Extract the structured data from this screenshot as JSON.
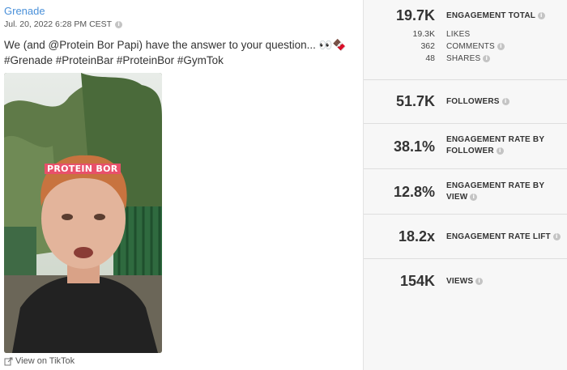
{
  "post": {
    "brand": "Grenade",
    "date": "Jul. 20, 2022 6:28 PM CEST",
    "caption_line1": "We (and @Protein Bor Papi) have the answer to your question... 👀🍫",
    "caption_line2": "#Grenade #ProteinBar #ProteinBor #GymTok",
    "video_overlay": "PROTEIN BOR",
    "view_link": "View on TikTok"
  },
  "metrics": {
    "engagement_total": {
      "value": "19.7K",
      "label": "ENGAGEMENT TOTAL"
    },
    "likes": {
      "value": "19.3K",
      "label": "LIKES"
    },
    "comments": {
      "value": "362",
      "label": "COMMENTS"
    },
    "shares": {
      "value": "48",
      "label": "SHARES"
    },
    "followers": {
      "value": "51.7K",
      "label": "FOLLOWERS"
    },
    "er_follower": {
      "value": "38.1%",
      "label1": "ENGAGEMENT RATE BY",
      "label2": "FOLLOWER"
    },
    "er_view": {
      "value": "12.8%",
      "label1": "ENGAGEMENT RATE BY",
      "label2": "VIEW"
    },
    "er_lift": {
      "value": "18.2x",
      "label": "ENGAGEMENT RATE LIFT"
    },
    "views": {
      "value": "154K",
      "label": "VIEWS"
    }
  },
  "icons": {
    "info": "info-icon",
    "external_link": "external-link-icon"
  }
}
